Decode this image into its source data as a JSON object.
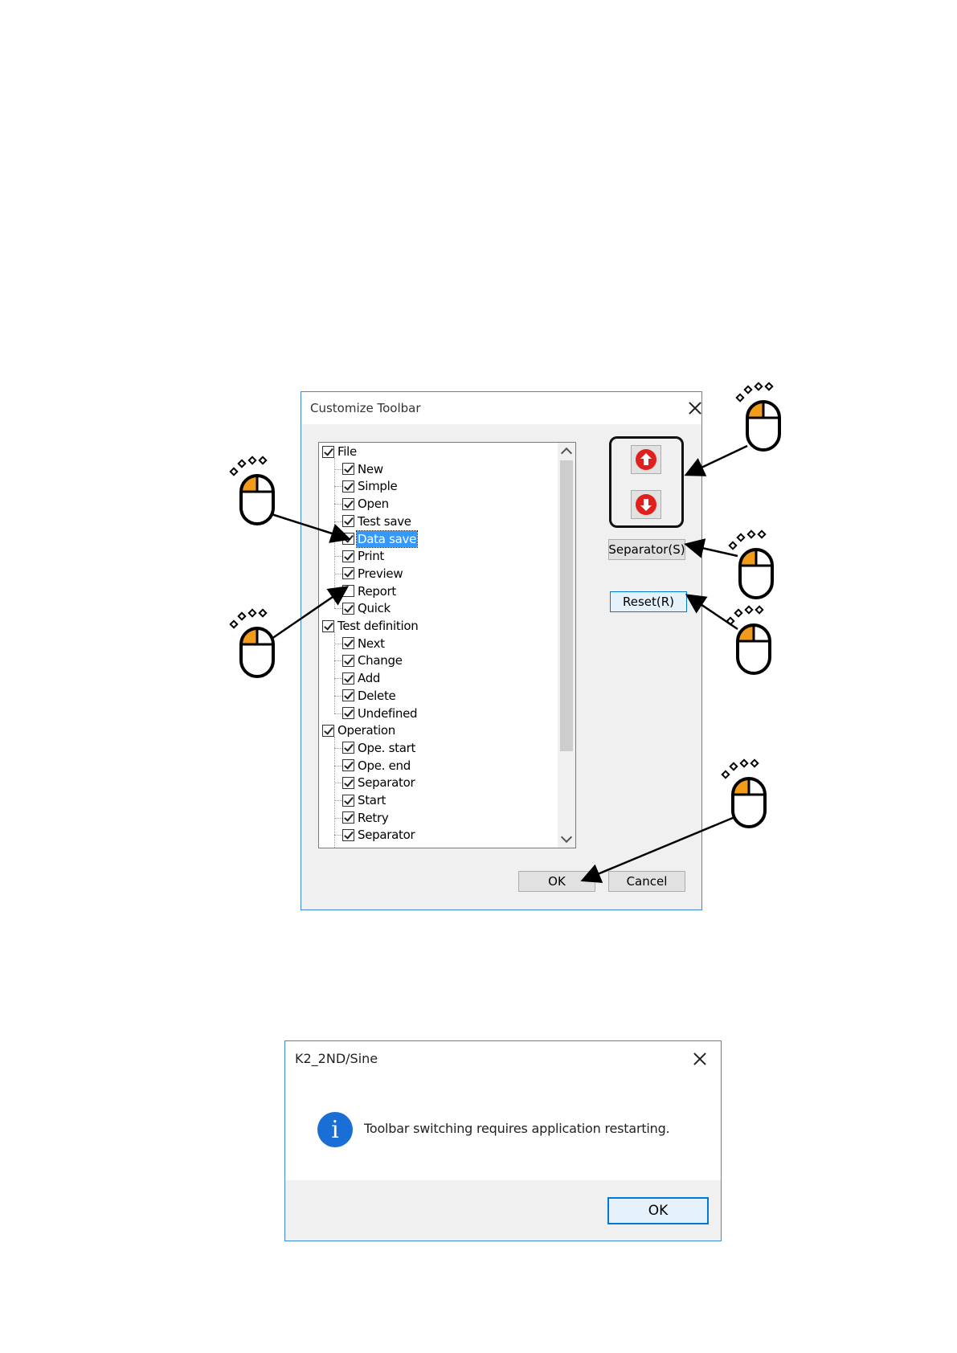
{
  "customize_dialog": {
    "title": "Customize Toolbar",
    "tree": [
      {
        "label": "File",
        "checked": true,
        "level": 0
      },
      {
        "label": "New",
        "checked": true,
        "level": 1
      },
      {
        "label": "Simple",
        "checked": true,
        "level": 1
      },
      {
        "label": "Open",
        "checked": true,
        "level": 1
      },
      {
        "label": "Test save",
        "checked": true,
        "level": 1
      },
      {
        "label": "Data save",
        "checked": true,
        "level": 1,
        "selected": true
      },
      {
        "label": "Print",
        "checked": true,
        "level": 1
      },
      {
        "label": "Preview",
        "checked": true,
        "level": 1
      },
      {
        "label": "Report",
        "checked": false,
        "level": 1
      },
      {
        "label": "Quick",
        "checked": true,
        "level": 1
      },
      {
        "label": "Test definition",
        "checked": true,
        "level": 0
      },
      {
        "label": "Next",
        "checked": true,
        "level": 1
      },
      {
        "label": "Change",
        "checked": true,
        "level": 1
      },
      {
        "label": "Add",
        "checked": true,
        "level": 1
      },
      {
        "label": "Delete",
        "checked": true,
        "level": 1
      },
      {
        "label": "Undefined",
        "checked": true,
        "level": 1
      },
      {
        "label": "Operation",
        "checked": true,
        "level": 0
      },
      {
        "label": "Ope. start",
        "checked": true,
        "level": 1
      },
      {
        "label": "Ope. end",
        "checked": true,
        "level": 1
      },
      {
        "label": "Separator",
        "checked": true,
        "level": 1
      },
      {
        "label": "Start",
        "checked": true,
        "level": 1
      },
      {
        "label": "Retry",
        "checked": true,
        "level": 1
      },
      {
        "label": "Separator",
        "checked": true,
        "level": 1
      }
    ],
    "separator_button": "Separator(S)",
    "reset_button": "Reset(R)",
    "ok_button": "OK",
    "cancel_button": "Cancel"
  },
  "message_dialog": {
    "title": "K2_2ND/Sine",
    "message": "Toolbar switching requires application restarting.",
    "info_icon_glyph": "i",
    "ok_button": "OK"
  },
  "colors": {
    "mouse_button_accent": "#f29a1a",
    "selection": "#3399ff",
    "up_down_icon": "#e0201c",
    "info_icon": "#1a6fd6"
  }
}
